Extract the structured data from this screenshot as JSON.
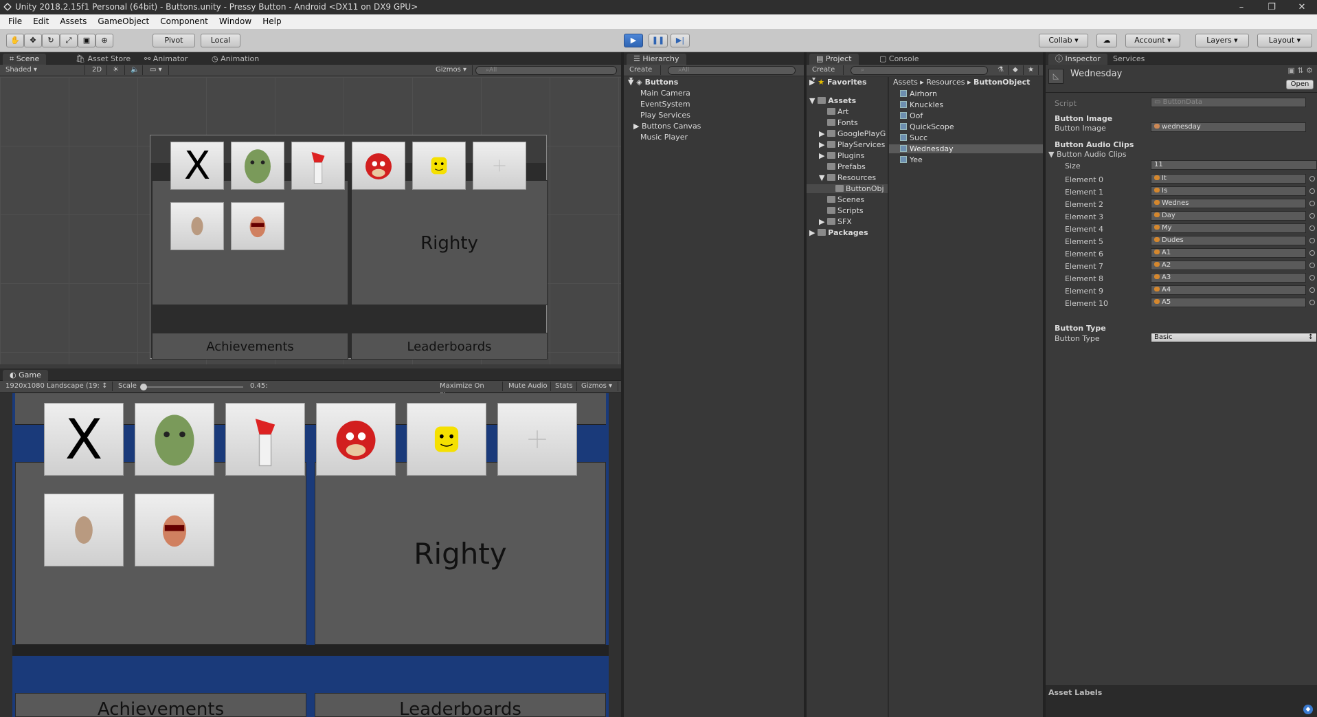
{
  "window": {
    "title": "Unity 2018.2.15f1 Personal (64bit) - Buttons.unity - Pressy Button - Android <DX11 on DX9 GPU>",
    "min": "–",
    "max": "❐",
    "close": "✕"
  },
  "menu": [
    "File",
    "Edit",
    "Assets",
    "GameObject",
    "Component",
    "Window",
    "Help"
  ],
  "toolbar": {
    "pivot": "Pivot",
    "local": "Local",
    "collab": "Collab",
    "account": "Account",
    "layers": "Layers",
    "layout": "Layout",
    "play_icon": "play-icon",
    "pause_icon": "pause-icon",
    "step_icon": "step-icon"
  },
  "scene": {
    "tabs": [
      "Scene",
      "Asset Store",
      "Animator",
      "Animation"
    ],
    "shading": "Shaded",
    "mode2d": "2D",
    "gizmos": "Gizmos",
    "search_placeholder": "All",
    "righty": "Righty",
    "achievements": "Achievements",
    "leaderboards": "Leaderboards",
    "x_label": "X"
  },
  "game": {
    "tab": "Game",
    "resolution": "1920x1080 Landscape (19:",
    "scale_label": "Scale",
    "scale_value": "0.45:",
    "scale_fraction": 0.02,
    "maximize": "Maximize On Play",
    "mute": "Mute Audio",
    "stats": "Stats",
    "gizmos": "Gizmos",
    "righty": "Righty",
    "achievements": "Achievements",
    "leaderboards": "Leaderboards",
    "x_label": "X"
  },
  "hierarchy": {
    "tab": "Hierarchy",
    "create": "Create",
    "search_placeholder": "All",
    "scene_name": "Buttons",
    "items": [
      "Main Camera",
      "EventSystem",
      "Play Services",
      "Buttons Canvas",
      "Music Player"
    ]
  },
  "project": {
    "tab": "Project",
    "console_tab": "Console",
    "create": "Create",
    "favorites": "Favorites",
    "assets": "Assets",
    "folders": [
      "Art",
      "Fonts",
      "GooglePlayG",
      "PlayServices",
      "Plugins",
      "Prefabs",
      "Resources",
      "ButtonObj",
      "Scenes",
      "Scripts",
      "SFX"
    ],
    "packages": "Packages",
    "breadcrumb": [
      "Assets",
      "Resources",
      "ButtonObject"
    ],
    "files": [
      "Airhorn",
      "Knuckles",
      "Oof",
      "QuickScope",
      "Succ",
      "Wednesday",
      "Yee"
    ]
  },
  "inspector": {
    "tab": "Inspector",
    "services_tab": "Services",
    "object_name": "Wednesday",
    "open": "Open",
    "script_label": "Script",
    "script_value": "ButtonData",
    "image_header": "Button Image",
    "image_label": "Button Image",
    "image_value": "wednesday",
    "audio_header": "Button Audio Clips",
    "audio_foldout": "Button Audio Clips",
    "size_label": "Size",
    "size_value": "11",
    "elements": [
      {
        "label": "Element 0",
        "value": "It"
      },
      {
        "label": "Element 1",
        "value": "Is"
      },
      {
        "label": "Element 2",
        "value": "Wednes"
      },
      {
        "label": "Element 3",
        "value": "Day"
      },
      {
        "label": "Element 4",
        "value": "My"
      },
      {
        "label": "Element 5",
        "value": "Dudes"
      },
      {
        "label": "Element 6",
        "value": "A1"
      },
      {
        "label": "Element 7",
        "value": "A2"
      },
      {
        "label": "Element 8",
        "value": "A3"
      },
      {
        "label": "Element 9",
        "value": "A4"
      },
      {
        "label": "Element 10",
        "value": "A5"
      }
    ],
    "type_header": "Button Type",
    "type_label": "Button Type",
    "type_value": "Basic",
    "asset_labels": "Asset Labels"
  }
}
